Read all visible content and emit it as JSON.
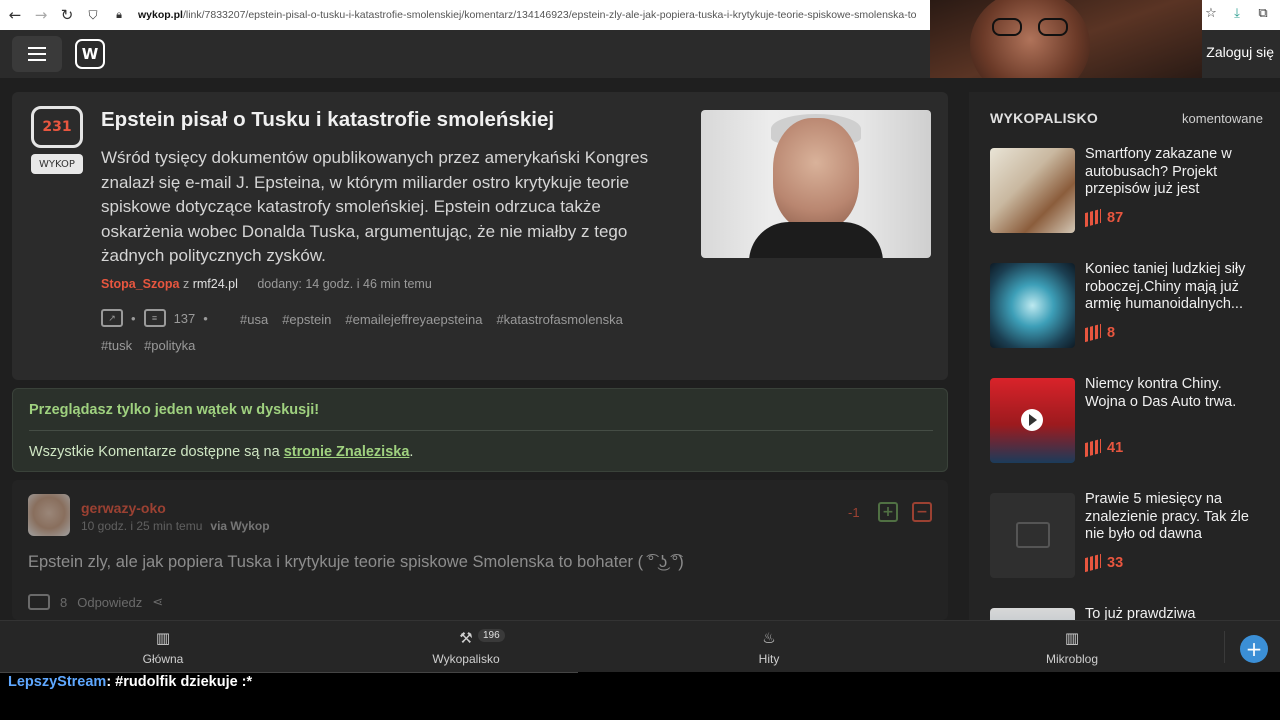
{
  "browser": {
    "url_domain": "wykop.pl",
    "url_path": "/link/7833207/epstein-pisal-o-tusku-i-katastrofie-smolenskiej/komentarz/134146923/epstein-zly-ale-jak-popiera-tuska-i-krytykuje-teorie-spiskowe-smolenska-to"
  },
  "header": {
    "logo_text": "W",
    "login_label": "Zaloguj się"
  },
  "article": {
    "votes": "231",
    "vote_button": "WYKOP",
    "title": "Epstein pisał o Tusku i katastrofie smoleńskiej",
    "description": "Wśród tysięcy dokumentów opublikowanych przez amerykański Kongres znalazł się e-mail J. Epsteina, w którym miliarder ostro krytykuje teorie spiskowe dotyczące katastrofy smoleńskiej. Epstein odrzuca także oskarżenia wobec Donalda Tuska, argumentując, że nie miałby z tego żadnych politycznych zysków.",
    "author": "Stopa_Szopa",
    "from_word": "z",
    "source": "rmf24.pl",
    "added": "dodany: 14 godz. i 46 min temu",
    "comments_count": "137",
    "bullet": "•",
    "tags_row1": [
      "#usa",
      "#epstein",
      "#emailejeffreyaepsteina",
      "#katastrofasmolenska"
    ],
    "tags_row2": [
      "#tusk",
      "#polityka"
    ]
  },
  "notice": {
    "title": "Przeglądasz tylko jeden wątek w dyskusji!",
    "text_before": "Wszystkie Komentarze dostępne są na ",
    "link_text": "stronie Znaleziska",
    "text_after": "."
  },
  "comment": {
    "user": "gerwazy-oko",
    "time": "10 godz. i 25 min temu",
    "via": "via Wykop",
    "score": "-1",
    "text": "Epstein zly, ale jak popiera Tuska i krytykuje teorie spiskowe Smolenska to bohater ( ͡° ͜ʖ ͡°)",
    "replies": "8",
    "reply_label": "Odpowiedz"
  },
  "sidebar": {
    "heading": "WYKOPALISKO",
    "tab": "komentowane",
    "items": [
      {
        "title": "Smartfony zakazane w autobusach? Projekt przepisów już jest",
        "score": "87"
      },
      {
        "title": "Koniec taniej ludzkiej siły roboczej.Chiny mają już armię humanoidalnych...",
        "score": "8"
      },
      {
        "title": "Niemcy kontra Chiny. Wojna o Das Auto trwa.",
        "score": "41"
      },
      {
        "title": "Prawie 5 miesięcy na znalezienie pracy. Tak źle nie było od dawna",
        "score": "33"
      },
      {
        "title": "To już prawdziwa",
        "score": ""
      }
    ]
  },
  "bottom_nav": {
    "items": [
      {
        "label": "Główna"
      },
      {
        "label": "Wykopalisko",
        "badge": "196"
      },
      {
        "label": "Hity"
      },
      {
        "label": "Mikroblog"
      }
    ]
  },
  "chat": {
    "user": "LepszyStream",
    "message": ": #rudolfik dziekuje :*"
  },
  "colors": {
    "accent": "#e8563f",
    "notice_green": "#9fd17f",
    "plus_blue": "#3b8fd6"
  }
}
